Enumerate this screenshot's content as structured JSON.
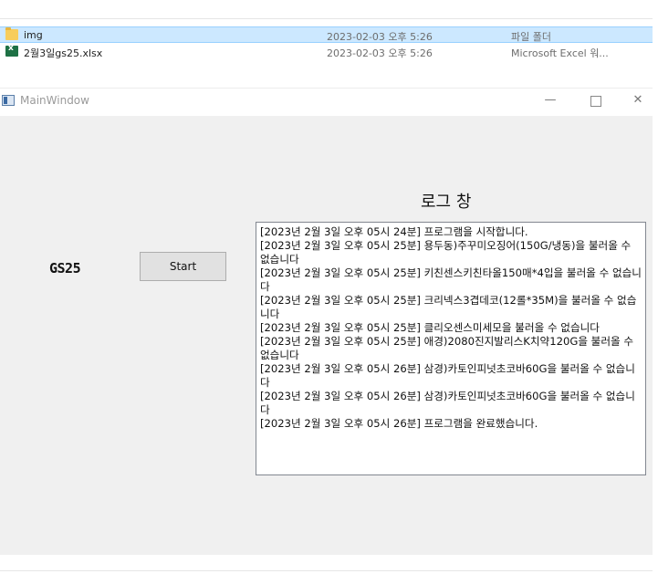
{
  "explorer": {
    "files": [
      {
        "icon": "folder-icon",
        "name": "img",
        "date": "2023-02-03 오후 5:26",
        "type": "파일 폴더",
        "selected": true
      },
      {
        "icon": "excel-file-icon",
        "name": "2월3일gs25.xlsx",
        "date": "2023-02-03 오후 5:26",
        "type": "Microsoft Excel 워...",
        "selected": false
      }
    ]
  },
  "window": {
    "title": "MainWindow",
    "controls": {
      "minimize": "—",
      "close": "✕"
    }
  },
  "main": {
    "store_label": "GS25",
    "start_button": "Start",
    "log_title": "로그 창",
    "log_lines": [
      "[2023년 2월 3일 오후 05시 24분] 프로그램을 시작합니다.",
      "[2023년 2월 3일 오후 05시 25분] 용두동)주꾸미오징어(150G/냉동)을 불러올 수 없습니다",
      "[2023년 2월 3일 오후 05시 25분] 키친센스키친타올150매*4입을 불러올 수 없습니다",
      "[2023년 2월 3일 오후 05시 25분] 크리넥스3겹데코(12롤*35M)을 불러올 수 없습니다",
      "[2023년 2월 3일 오후 05시 25분] 클리오센스미세모을 불러올 수 없습니다",
      "[2023년 2월 3일 오후 05시 25분] 애경)2080진지발리스K치약120G을 불러올 수 없습니다",
      "[2023년 2월 3일 오후 05시 26분] 삼경)카토인피넛초코바60G을 불러올 수 없습니다",
      "[2023년 2월 3일 오후 05시 26분] 삼경)카토인피넛초코바60G을 불러올 수 없습니다",
      "[2023년 2월 3일 오후 05시 26분] 프로그램을 완료했습니다."
    ]
  }
}
